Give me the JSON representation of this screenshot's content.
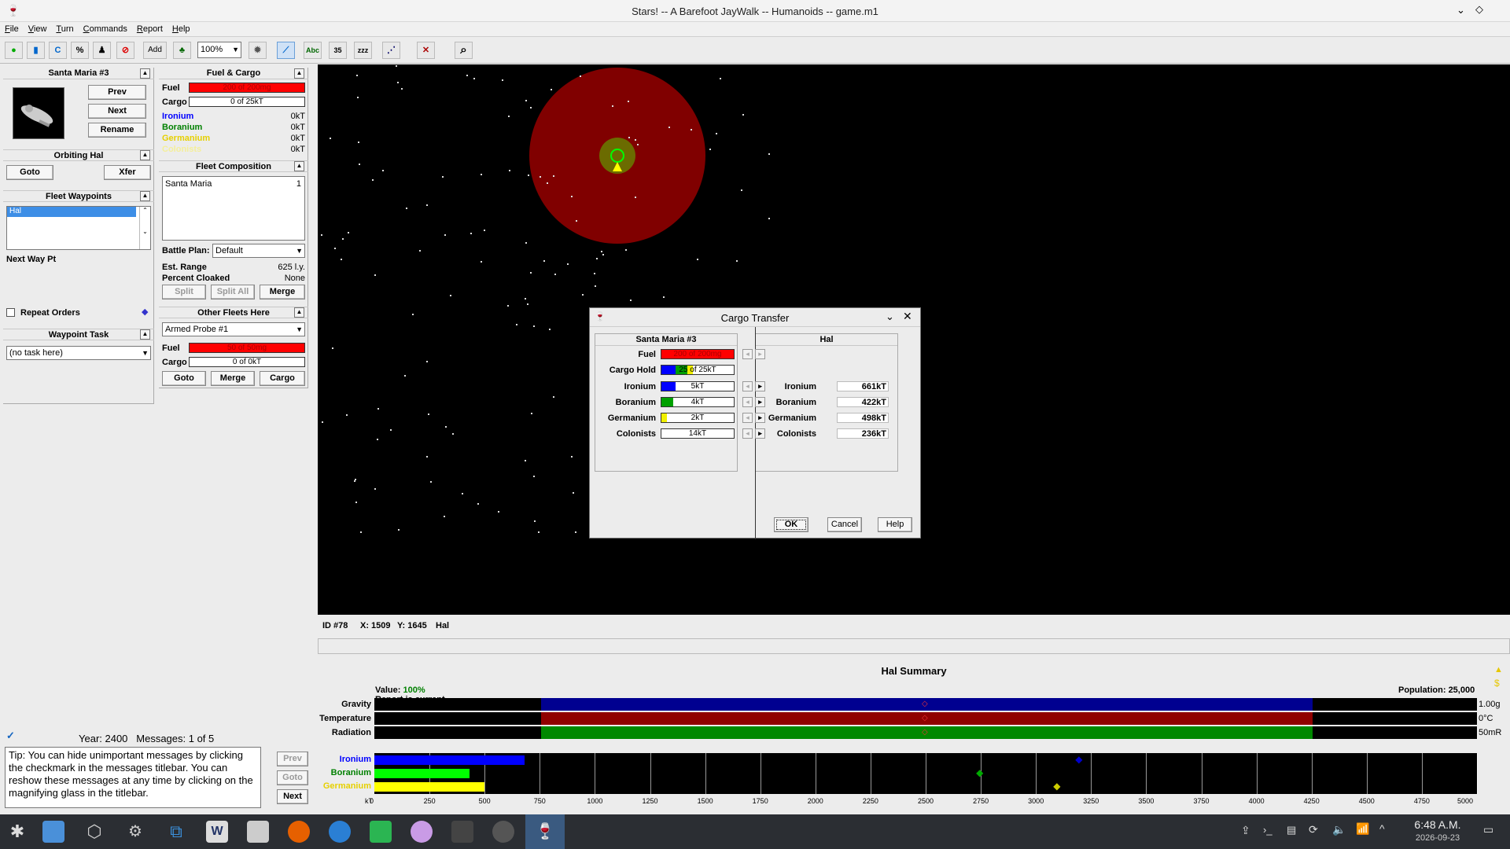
{
  "window": {
    "title": "Stars! -- A Barefoot JayWalk -- Humanoids -- game.m1"
  },
  "menu": [
    "File",
    "View",
    "Turn",
    "Commands",
    "Report",
    "Help"
  ],
  "toolbar": {
    "zoom": "100%",
    "add_label": "Add",
    "count": "35",
    "abc": "Abc"
  },
  "fleet": {
    "name": "Santa Maria #3",
    "prev": "Prev",
    "next": "Next",
    "rename": "Rename",
    "orbiting": "Orbiting Hal",
    "goto": "Goto",
    "xfer": "Xfer",
    "waypoints_title": "Fleet Waypoints",
    "waypoints": [
      "Hal"
    ],
    "next_way_pt": "Next Way Pt",
    "repeat_orders": "Repeat Orders",
    "waypoint_task_title": "Waypoint Task",
    "waypoint_task": "(no task here)"
  },
  "fuel_cargo": {
    "title": "Fuel & Cargo",
    "fuel_label": "Fuel",
    "fuel_text": "200 of 200mg",
    "fuel_fraction": 1.0,
    "cargo_label": "Cargo",
    "cargo_text": "0 of 25kT",
    "cargo_fraction": 0,
    "minerals": [
      {
        "name": "Ironium",
        "value": "0kT",
        "color": "#0000ff"
      },
      {
        "name": "Boranium",
        "value": "0kT",
        "color": "#008000"
      },
      {
        "name": "Germanium",
        "value": "0kT",
        "color": "#e6d000"
      },
      {
        "name": "Colonists",
        "value": "0kT",
        "color": "#e6d000"
      }
    ]
  },
  "composition": {
    "title": "Fleet Composition",
    "ships": [
      {
        "name": "Santa Maria",
        "count": "1"
      }
    ],
    "battle_plan_label": "Battle Plan:",
    "battle_plan": "Default",
    "range_label": "Est. Range",
    "range": "625 l.y.",
    "cloak_label": "Percent Cloaked",
    "cloak": "None",
    "split": "Split",
    "split_all": "Split All",
    "merge": "Merge"
  },
  "other_fleets": {
    "title": "Other Fleets Here",
    "selected": "Armed Probe #1",
    "fuel_label": "Fuel",
    "fuel_text": "50 of 50mg",
    "fuel_fraction": 1.0,
    "cargo_label": "Cargo",
    "cargo_text": "0 of 0kT",
    "goto": "Goto",
    "merge": "Merge",
    "cargo": "Cargo"
  },
  "messages": {
    "year_label": "Year: 2400",
    "count": "Messages: 1 of 5",
    "tip": "Tip: You can hide unimportant messages by clicking the checkmark in the messages titlebar. You can reshow these messages at any time by clicking on the magnifying glass in the titlebar.",
    "prev": "Prev",
    "goto": "Goto",
    "next": "Next"
  },
  "cargo_dialog": {
    "title": "Cargo Transfer",
    "left_title": "Santa Maria #3",
    "right_title": "Hal",
    "fuel_label": "Fuel",
    "fuel_text": "200 of 200mg",
    "fuel_fraction": 1.0,
    "hold_label": "Cargo Hold",
    "hold_text": "25 of 25kT",
    "rows": [
      {
        "name": "Ironium",
        "ship": "5kT",
        "fraction": 0.2,
        "color": "#0000ff",
        "planet": "661kT"
      },
      {
        "name": "Boranium",
        "ship": "4kT",
        "fraction": 0.16,
        "color": "#00a000",
        "planet": "422kT"
      },
      {
        "name": "Germanium",
        "ship": "2kT",
        "fraction": 0.08,
        "color": "#f0f000",
        "planet": "498kT"
      },
      {
        "name": "Colonists",
        "ship": "14kT",
        "fraction": 0,
        "color": "#ffffff",
        "planet": "236kT"
      }
    ],
    "ok": "OK",
    "cancel": "Cancel",
    "help": "Help"
  },
  "status": {
    "id": "ID #78",
    "x": "X: 1509",
    "y": "Y: 1645",
    "name": "Hal"
  },
  "summary": {
    "title": "Hal Summary",
    "value_label": "Value:",
    "value": "100%",
    "report": "Report is current",
    "population_label": "Population:",
    "population": "25,000",
    "hab": [
      {
        "name": "Gravity",
        "color": "#000090",
        "right": "1.00g"
      },
      {
        "name": "Temperature",
        "color": "#900000",
        "right": "0°C"
      },
      {
        "name": "Radiation",
        "color": "#008800",
        "right": "50mR"
      }
    ],
    "minerals": [
      {
        "name": "Ironium",
        "value": 680,
        "color": "#0000ff",
        "marker": 3200
      },
      {
        "name": "Boranium",
        "value": 430,
        "color": "#00ff00",
        "marker": 2750
      },
      {
        "name": "Germanium",
        "value": 500,
        "color": "#ffff00",
        "marker": 3100
      }
    ],
    "axis_unit": "kT",
    "axis": [
      "0",
      "250",
      "500",
      "750",
      "1000",
      "1250",
      "1500",
      "1750",
      "2000",
      "2250",
      "2500",
      "2750",
      "3000",
      "3250",
      "3500",
      "3750",
      "4000",
      "4250",
      "4500",
      "4750",
      "5000"
    ]
  },
  "clock": {
    "time": "6:48 A.M.",
    "date": "2026-09-23"
  }
}
